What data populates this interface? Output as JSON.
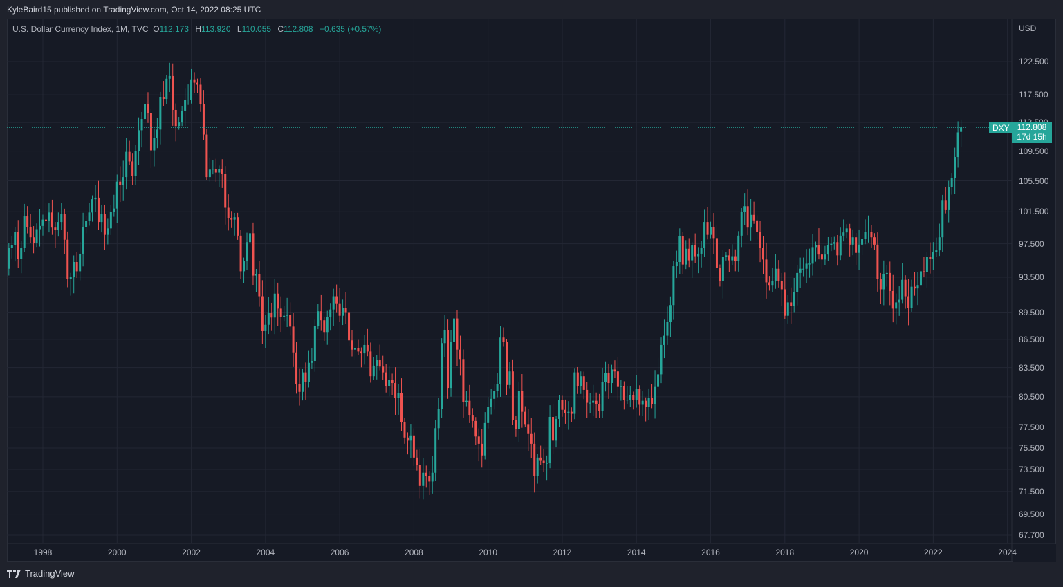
{
  "header": {
    "published": "KyleBaird15 published on TradingView.com, Oct 14, 2022 08:25 UTC"
  },
  "legend": {
    "title": "U.S. Dollar Currency Index, 1M, TVC",
    "o_label": "O",
    "o": "112.173",
    "h_label": "H",
    "h": "113.920",
    "l_label": "L",
    "l": "110.055",
    "c_label": "C",
    "c": "112.808",
    "change": "+0.635 (+0.57%)"
  },
  "price_axis": {
    "currency": "USD",
    "ticks": [
      "122.500",
      "117.500",
      "113.500",
      "109.500",
      "105.500",
      "101.500",
      "97.500",
      "93.500",
      "89.500",
      "86.500",
      "83.500",
      "80.500",
      "77.500",
      "75.500",
      "73.500",
      "71.500",
      "69.500",
      "67.700"
    ]
  },
  "time_axis": {
    "ticks": [
      "1998",
      "2000",
      "2002",
      "2004",
      "2006",
      "2008",
      "2010",
      "2012",
      "2014",
      "2016",
      "2018",
      "2020",
      "2022",
      "2024"
    ]
  },
  "last_price": {
    "symbol": "DXY",
    "price": "112.808",
    "countdown": "17d 15h"
  },
  "footer": {
    "brand": "TradingView"
  },
  "colors": {
    "up": "#26a69a",
    "down": "#ef5350",
    "grid": "#232734"
  },
  "chart_data": {
    "type": "candlestick",
    "title": "U.S. Dollar Currency Index, 1M, TVC",
    "scale": "log",
    "ylim": [
      66.5,
      125
    ],
    "start_month": "1997-01",
    "first_open": 93.0,
    "last_candle": {
      "open": 112.173,
      "high": 113.92,
      "low": 110.055,
      "close": 112.808
    },
    "closes": [
      94.5,
      97.0,
      97.3,
      99.0,
      95.7,
      97.0,
      100.9,
      99.6,
      98.3,
      97.6,
      99.3,
      99.7,
      100.5,
      100.3,
      101.4,
      99.5,
      99.2,
      100.2,
      101.2,
      98.0,
      93.3,
      93.5,
      95.3,
      94.2,
      96.3,
      99.6,
      100.3,
      101.4,
      103.1,
      103.3,
      100.2,
      101.2,
      98.6,
      99.4,
      101.5,
      101.9,
      105.4,
      105.0,
      106.0,
      109.4,
      108.1,
      106.1,
      109.5,
      112.4,
      114.0,
      116.2,
      114.8,
      109.6,
      111.3,
      112.5,
      117.2,
      116.9,
      119.9,
      120.3,
      115.3,
      113.0,
      113.5,
      115.2,
      116.8,
      116.8,
      119.8,
      119.3,
      119.0,
      116.1,
      111.8,
      106.0,
      107.0,
      107.1,
      106.6,
      107.1,
      106.4,
      102.0,
      100.7,
      100.5,
      100.8,
      98.5,
      94.2,
      95.4,
      97.7,
      98.8,
      93.7,
      93.9,
      91.3,
      87.4,
      88.1,
      89.4,
      88.9,
      91.6,
      89.9,
      89.0,
      89.1,
      89.2,
      87.9,
      85.1,
      81.8,
      81.0,
      83.0,
      82.0,
      84.0,
      84.2,
      88.0,
      89.6,
      88.6,
      87.3,
      89.0,
      89.8,
      91.3,
      90.5,
      89.1,
      90.0,
      89.5,
      86.4,
      85.4,
      85.6,
      85.2,
      85.0,
      85.9,
      85.2,
      82.6,
      83.7,
      84.3,
      83.6,
      83.0,
      81.6,
      82.2,
      81.9,
      80.4,
      80.9,
      78.0,
      76.5,
      76.2,
      76.7,
      74.6,
      73.9,
      72.0,
      73.2,
      72.9,
      72.4,
      73.2,
      77.4,
      79.3,
      86.1,
      87.5,
      81.4,
      86.2,
      88.8,
      85.4,
      84.4,
      80.0,
      80.1,
      78.7,
      78.1,
      76.6,
      75.9,
      74.8,
      77.9,
      79.5,
      80.3,
      81.1,
      81.8,
      86.7,
      86.2,
      81.7,
      83.1,
      78.2,
      77.3,
      81.1,
      79.0,
      77.8,
      76.9,
      75.9,
      72.9,
      74.6,
      74.3,
      74.1,
      74.1,
      78.5,
      76.2,
      78.3,
      80.2,
      79.2,
      78.9,
      79.0,
      78.8,
      83.0,
      81.6,
      82.6,
      81.2,
      79.9,
      79.9,
      80.1,
      79.8,
      79.1,
      82.0,
      82.9,
      81.9,
      83.3,
      83.1,
      81.5,
      81.6,
      80.2,
      80.2,
      80.7,
      80.2,
      81.3,
      79.7,
      80.1,
      79.5,
      80.4,
      79.8,
      81.5,
      82.8,
      85.9,
      86.9,
      88.4,
      90.3,
      94.8,
      95.3,
      98.4,
      95.0,
      96.9,
      95.5,
      97.3,
      96.0,
      96.3,
      97.0,
      100.2,
      98.6,
      99.6,
      98.2,
      94.6,
      93.1,
      95.9,
      96.1,
      95.5,
      96.0,
      95.4,
      98.5,
      101.5,
      102.2,
      99.5,
      101.1,
      100.4,
      99.0,
      97.0,
      95.6,
      92.9,
      92.6,
      93.1,
      94.5,
      93.1,
      92.1,
      89.1,
      90.6,
      90.2,
      91.8,
      94.0,
      94.5,
      94.5,
      95.1,
      95.1,
      97.1,
      97.3,
      96.2,
      95.6,
      96.2,
      97.3,
      97.5,
      97.7,
      96.1,
      98.5,
      98.9,
      99.4,
      97.4,
      98.3,
      96.4,
      97.4,
      98.1,
      99.0,
      99.0,
      98.3,
      97.4,
      93.3,
      92.1,
      93.9,
      94.0,
      91.9,
      89.9,
      90.6,
      90.9,
      93.2,
      91.3,
      90.0,
      92.4,
      92.2,
      92.6,
      94.2,
      94.1,
      95.9,
      95.7,
      96.5,
      96.7,
      98.3,
      103.0,
      101.7,
      104.7,
      105.9,
      108.7,
      112.1,
      112.808
    ]
  }
}
